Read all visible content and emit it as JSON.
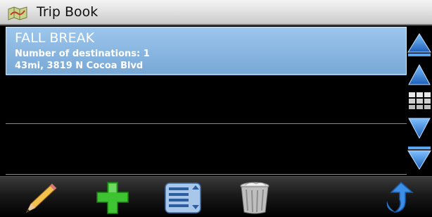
{
  "window": {
    "title": "Trip Book",
    "icon": "map-icon"
  },
  "trips": [
    {
      "name": "FALL BREAK",
      "destinations": "Number of destinations: 1",
      "detail": "43mi, 3819 N Cocoa Blvd",
      "selected": true
    }
  ],
  "scroll": {
    "icons": [
      "page-up-icon",
      "line-up-icon",
      "keyboard-grid-icon",
      "line-down-icon",
      "page-down-icon"
    ]
  },
  "toolbar": {
    "icons": [
      "pencil-icon",
      "plus-icon",
      "list-icon",
      "trash-icon",
      "back-arrow-icon"
    ]
  },
  "colors": {
    "selected_row": "#8ab8e4",
    "row_divider": "#6a8cb6",
    "scroll_arrow": "#2f7fd8",
    "plus": "#3ec431"
  }
}
